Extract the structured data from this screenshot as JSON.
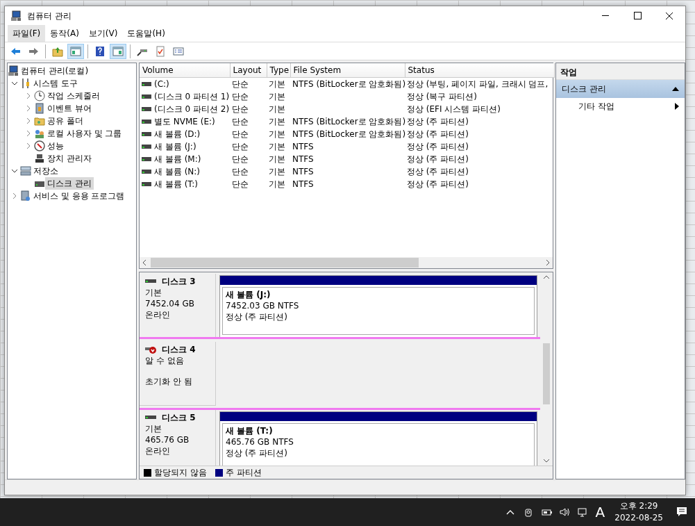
{
  "window": {
    "title": "컴퓨터 관리"
  },
  "menu": [
    {
      "label": "파일(F)",
      "highlighted": true
    },
    {
      "label": "동작(A)",
      "highlighted": false
    },
    {
      "label": "보기(V)",
      "highlighted": false
    },
    {
      "label": "도움말(H)",
      "highlighted": false
    }
  ],
  "toolbar": [
    {
      "kind": "button",
      "pressed": false
    },
    {
      "kind": "button",
      "pressed": false
    },
    {
      "kind": "separator"
    },
    {
      "kind": "button",
      "pressed": false
    },
    {
      "kind": "button",
      "pressed": true
    },
    {
      "kind": "separator"
    },
    {
      "kind": "button",
      "pressed": false
    },
    {
      "kind": "button",
      "pressed": true
    },
    {
      "kind": "separator"
    },
    {
      "kind": "button",
      "pressed": false
    },
    {
      "kind": "button",
      "pressed": false
    },
    {
      "kind": "button",
      "pressed": false
    }
  ],
  "tree": [
    {
      "label": "컴퓨터 관리(로컬)",
      "selected": false,
      "children": [
        {
          "label": "시스템 도구",
          "selected": false,
          "expanded": true,
          "children": [
            {
              "label": "작업 스케줄러",
              "selected": false,
              "expanded": false
            },
            {
              "label": "이벤트 뷰어",
              "selected": false,
              "expanded": false
            },
            {
              "label": "공유 폴더",
              "selected": false,
              "expanded": false
            },
            {
              "label": "로컬 사용자 및 그룹",
              "selected": false,
              "expanded": false
            },
            {
              "label": "성능",
              "selected": false,
              "expanded": false
            },
            {
              "label": "장치 관리자",
              "selected": false
            }
          ]
        },
        {
          "label": "저장소",
          "selected": false,
          "expanded": true,
          "children": [
            {
              "label": "디스크 관리",
              "selected": true
            }
          ]
        },
        {
          "label": "서비스 및 응용 프로그램",
          "selected": false,
          "expanded": false
        }
      ]
    }
  ],
  "volumes": {
    "columns": [
      "Volume",
      "Layout",
      "Type",
      "File System",
      "Status"
    ],
    "rows": [
      [
        "(C:)",
        "단순",
        "기본",
        "NTFS (BitLocker로 암호화됨)",
        "정상 (부팅, 페이지 파일, 크래시 덤프,"
      ],
      [
        "(디스크 0 파티션 1)",
        "단순",
        "기본",
        "",
        "정상 (복구 파티션)"
      ],
      [
        "(디스크 0 파티션 2)",
        "단순",
        "기본",
        "",
        "정상 (EFI 시스템 파티션)"
      ],
      [
        "별도 NVME (E:)",
        "단순",
        "기본",
        "NTFS (BitLocker로 암호화됨)",
        "정상 (주 파티션)"
      ],
      [
        "새 볼륨 (D:)",
        "단순",
        "기본",
        "NTFS (BitLocker로 암호화됨)",
        "정상 (주 파티션)"
      ],
      [
        "새 볼륨 (J:)",
        "단순",
        "기본",
        "NTFS",
        "정상 (주 파티션)"
      ],
      [
        "새 볼륨 (M:)",
        "단순",
        "기본",
        "NTFS",
        "정상 (주 파티션)"
      ],
      [
        "새 볼륨 (N:)",
        "단순",
        "기본",
        "NTFS",
        "정상 (주 파티션)"
      ],
      [
        "새 볼륨 (T:)",
        "단순",
        "기본",
        "NTFS",
        "정상 (주 파티션)"
      ]
    ]
  },
  "disks": [
    {
      "kind": "online",
      "name": "디스크 3",
      "type": "기본",
      "size": "7452.04 GB",
      "state": "온라인",
      "partitions": [
        {
          "name": "새 볼륨  (J:)",
          "size": "7452.03 GB NTFS",
          "status": "정상 (주 파티션)"
        }
      ]
    },
    {
      "kind": "unknown",
      "name": "디스크 4",
      "type": "알 수 없음",
      "state": "초기화 안 됨",
      "highlighted": true
    },
    {
      "kind": "online",
      "name": "디스크 5",
      "type": "기본",
      "size": "465.76 GB",
      "state": "온라인",
      "partitions": [
        {
          "name": "새 볼륨  (T:)",
          "size": "465.76 GB NTFS",
          "status": "정상 (주 파티션)"
        }
      ]
    }
  ],
  "legend": [
    {
      "label": "할당되지 않음",
      "color": "#000000"
    },
    {
      "label": "주 파티션",
      "color": "#000080"
    }
  ],
  "actions": {
    "title": "작업",
    "sections": [
      {
        "label": "디스크 관리",
        "items": [
          {
            "label": "기타 작업"
          }
        ]
      }
    ]
  },
  "taskbar": {
    "ime": "A",
    "time": "오후 2:29",
    "date": "2022-08-25"
  }
}
